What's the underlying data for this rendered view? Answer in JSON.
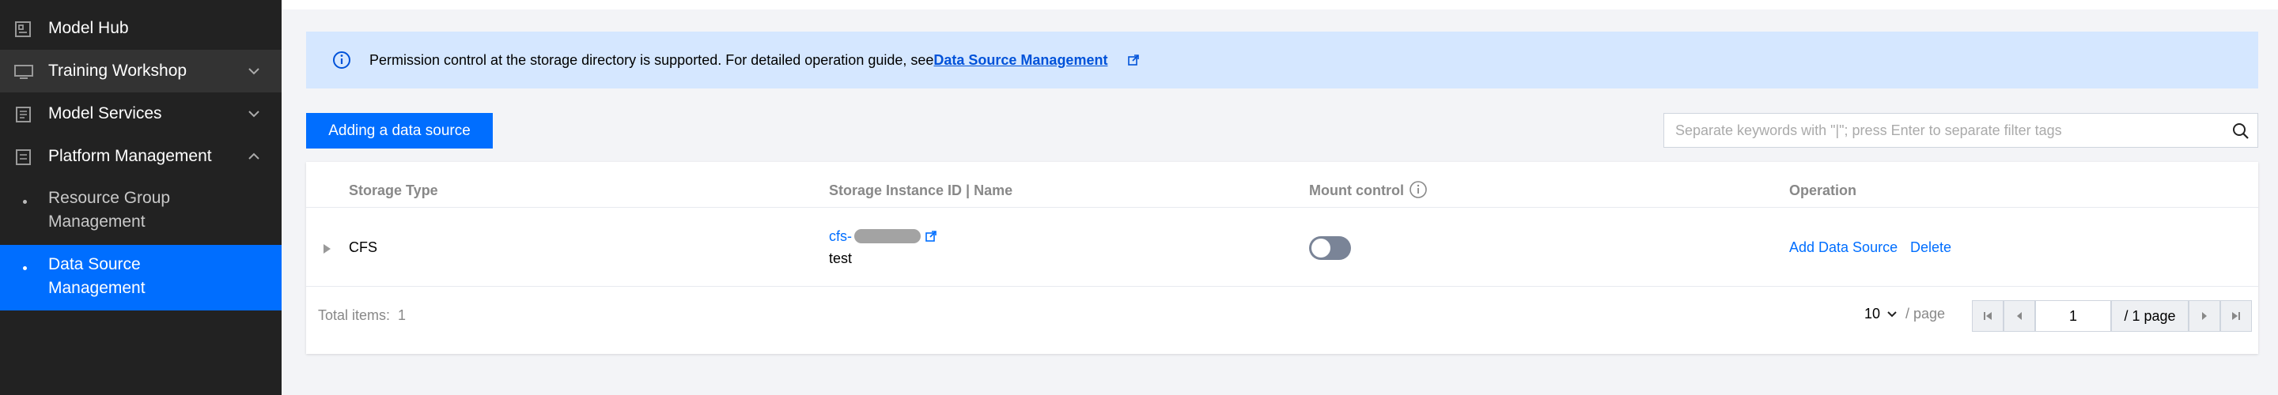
{
  "sidebar": {
    "items": [
      {
        "label": "Model Hub",
        "icon": "model-hub-icon"
      },
      {
        "label": "Training Workshop",
        "icon": "monitor-icon"
      },
      {
        "label": "Model Services",
        "icon": "service-doc-icon"
      },
      {
        "label": "Platform Management",
        "icon": "platform-doc-icon"
      }
    ],
    "sub_items": [
      {
        "label_line1": "Resource Group",
        "label_line2": "Management"
      },
      {
        "label_line1": "Data Source",
        "label_line2": "Management"
      }
    ]
  },
  "banner": {
    "text": "Permission control at the storage directory is supported. For detailed operation guide, see",
    "link": "Data Source Management"
  },
  "toolbar": {
    "add_label": "Adding a data source",
    "search_placeholder": "Separate keywords with \"|\"; press Enter to separate filter tags"
  },
  "table": {
    "headers": [
      "Storage Type",
      "Storage Instance ID | Name",
      "Mount control",
      "Operation"
    ],
    "rows": [
      {
        "storage_type": "CFS",
        "instance_id_prefix": "cfs-",
        "name": "test",
        "mount_enabled": false,
        "actions": [
          "Add Data Source",
          "Delete"
        ]
      }
    ]
  },
  "pagination": {
    "total_label": "Total items:",
    "total": "1",
    "page_size": "10",
    "per_page_label": "/ page",
    "current_page": "1",
    "total_pages_label": "/ 1 page"
  },
  "colors": {
    "sidebar_bg": "#222222",
    "accent": "#006eff",
    "banner_bg": "#d5e7ff",
    "link": "#0052d9"
  }
}
